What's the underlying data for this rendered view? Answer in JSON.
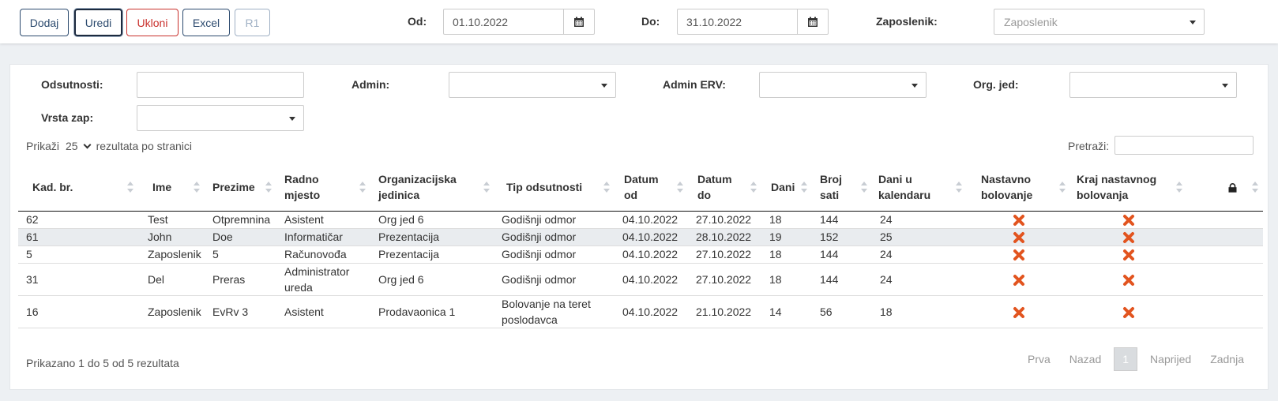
{
  "toolbar": {
    "add_label": "Dodaj",
    "edit_label": "Uredi",
    "remove_label": "Ukloni",
    "excel_label": "Excel",
    "r1_label": "R1",
    "from_label": "Od:",
    "from_value": "01.10.2022",
    "to_label": "Do:",
    "to_value": "31.10.2022",
    "employee_label": "Zaposlenik:",
    "employee_placeholder": "Zaposlenik"
  },
  "filters": {
    "absences_label": "Odsutnosti:",
    "admin_label": "Admin:",
    "admin_erv_label": "Admin ERV:",
    "org_unit_label": "Org. jed:",
    "emp_type_label": "Vrsta zap:"
  },
  "table_controls": {
    "show_label": "Prikaži",
    "page_size": "25",
    "per_page_label": "rezultata po stranici",
    "search_label": "Pretraži:"
  },
  "columns": [
    "Kad. br.",
    "Ime",
    "Prezime",
    "Radno mjesto",
    "Organizacijska jedinica",
    "Tip odsutnosti",
    "Datum od",
    "Datum do",
    "Dani",
    "Broj sati",
    "Dani u kalendaru",
    "Nastavno bolovanje",
    "Kraj nastavnog bolovanja"
  ],
  "rows": [
    {
      "kad_br": "62",
      "ime": "Test",
      "prezime": "Otpremnina",
      "radno_mjesto": "Asistent",
      "org_jed": "Org jed 6",
      "tip": "Godišnji odmor",
      "datum_od": "04.10.2022",
      "datum_do": "27.10.2022",
      "dani": "18",
      "sati": "144",
      "dani_kal": "24"
    },
    {
      "kad_br": "61",
      "ime": "John",
      "prezime": "Doe",
      "radno_mjesto": "Informatičar",
      "org_jed": "Prezentacija",
      "tip": "Godišnji odmor",
      "datum_od": "04.10.2022",
      "datum_do": "28.10.2022",
      "dani": "19",
      "sati": "152",
      "dani_kal": "25"
    },
    {
      "kad_br": "5",
      "ime": "Zaposlenik",
      "prezime": "5",
      "radno_mjesto": "Računovođa",
      "org_jed": "Prezentacija",
      "tip": "Godišnji odmor",
      "datum_od": "04.10.2022",
      "datum_do": "27.10.2022",
      "dani": "18",
      "sati": "144",
      "dani_kal": "24"
    },
    {
      "kad_br": "31",
      "ime": "Del",
      "prezime": "Preras",
      "radno_mjesto": "Administrator ureda",
      "org_jed": "Org jed 6",
      "tip": "Godišnji odmor",
      "datum_od": "04.10.2022",
      "datum_do": "27.10.2022",
      "dani": "18",
      "sati": "144",
      "dani_kal": "24"
    },
    {
      "kad_br": "16",
      "ime": "Zaposlenik",
      "prezime": "EvRv 3",
      "radno_mjesto": "Asistent",
      "org_jed": "Prodavaonica 1",
      "tip": "Bolovanje na teret poslodavca",
      "datum_od": "04.10.2022",
      "datum_do": "21.10.2022",
      "dani": "14",
      "sati": "56",
      "dani_kal": "18"
    }
  ],
  "footer": {
    "info": "Prikazano 1 do 5 od 5 rezultata",
    "first": "Prva",
    "prev": "Nazad",
    "current": "1",
    "next": "Naprijed",
    "last": "Zadnja"
  },
  "colors": {
    "primary": "#2c4a6e",
    "danger": "#c9302c",
    "x_icon": "#e2541f",
    "stripe": "#e9ecef"
  },
  "icons": {
    "calendar": "calendar-icon",
    "cross": "x-icon",
    "lock": "lock-icon"
  }
}
